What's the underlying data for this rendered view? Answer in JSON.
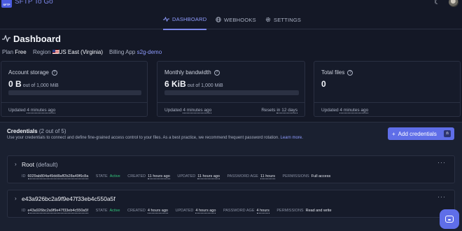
{
  "app": {
    "logo_text": "SFTP",
    "title": "SFTP To Go"
  },
  "nav": {
    "tabs": [
      {
        "label": "DASHBOARD",
        "icon": "activity-icon"
      },
      {
        "label": "WEBHOOKS",
        "icon": "globe-icon"
      },
      {
        "label": "SETTINGS",
        "icon": "gear-icon"
      }
    ]
  },
  "dashboard": {
    "title": "Dashboard",
    "plan_label": "Plan",
    "plan_value": "Free",
    "region_label": "Region",
    "region_value": "US East (Virginia)",
    "billing_label": "Billing App",
    "billing_value": "s2g-demo"
  },
  "cards": {
    "storage": {
      "label": "Account storage",
      "value": "0 B",
      "limit": "out of 1,000 MiB",
      "updated_label": "Updated",
      "updated_value": "4 minutes ago",
      "usage_fraction": 0
    },
    "bandwidth": {
      "label": "Monthly bandwidth",
      "value": "6 KiB",
      "limit": "out of 1,000 MiB",
      "updated_label": "Updated",
      "updated_value": "4 minutes ago",
      "resets_label": "Resets",
      "resets_value": "in 12 days",
      "usage_fraction": 0
    },
    "files": {
      "label": "Total files",
      "value": "0",
      "updated_label": "Updated",
      "updated_value": "4 minutes ago"
    }
  },
  "credentials": {
    "title": "Credentials",
    "count": "(2 out of 5)",
    "description": "Use your credentials to connect and define fine-grained access control to your files. As a best practice, we recommend frequent password rotation.",
    "learn_more": "Learn more.",
    "add_label": "Add credentials",
    "add_shortcut": "n",
    "field_labels": {
      "id": "ID",
      "state": "STATE",
      "created": "CREATED",
      "updated": "UPDATED",
      "password_age": "PASSWORD AGE",
      "permissions": "PERMISSIONS"
    },
    "items": [
      {
        "name": "Root",
        "tag": "(default)",
        "id": "6029ab804a49dd8aff2b28a49f6c8a",
        "state": "Active",
        "created": "11 hours ago",
        "updated": "11 hours ago",
        "password_age": "11 hours",
        "permissions": "Full access"
      },
      {
        "name": "e43a926bc2a9f9e47f33eb4c550a5f",
        "tag": "",
        "id": "e43a926bc2a9f9e47f33eb4c550a5f",
        "state": "Active",
        "created": "4 hours ago",
        "updated": "4 hours ago",
        "password_age": "4 hours",
        "permissions": "Read and write"
      }
    ]
  },
  "colors": {
    "accent": "#5f6ee8",
    "active": "#32c47a",
    "background": "#141826"
  }
}
